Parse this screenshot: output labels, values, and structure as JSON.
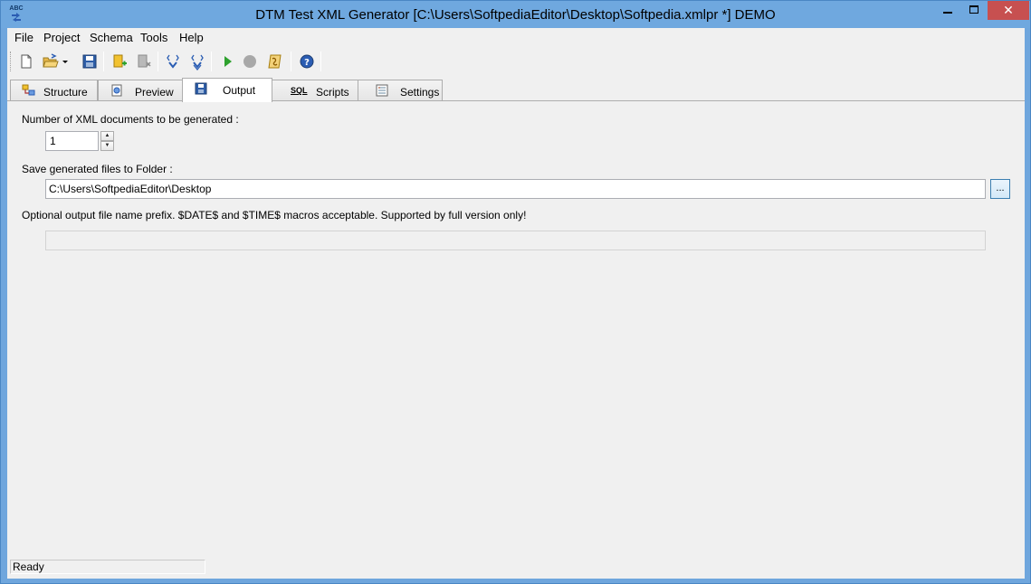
{
  "window": {
    "title": "DTM Test XML Generator [C:\\Users\\SoftpediaEditor\\Desktop\\Softpedia.xmlpr *] DEMO",
    "app_icon_text": "ABC",
    "close_glyph": "✕"
  },
  "menu": [
    "File",
    "Project",
    "Schema",
    "Tools",
    "Help"
  ],
  "toolbar": {
    "buttons": [
      "new-document",
      "open-folder",
      "open-dropdown",
      "save",
      "add-item",
      "remove-item",
      "move-down",
      "move-down-alt",
      "run",
      "stop",
      "script",
      "help"
    ]
  },
  "tabs": [
    {
      "label": "Structure",
      "icon": "structure-icon"
    },
    {
      "label": "Preview",
      "icon": "preview-icon"
    },
    {
      "label": "Output",
      "icon": "save-disk-icon",
      "active": true
    },
    {
      "label": "Scripts",
      "icon": "sql-icon",
      "icon_text": "SQL"
    },
    {
      "label": "Settings",
      "icon": "settings-icon"
    }
  ],
  "output": {
    "count_label": "Number of XML documents to be generated :",
    "count_value": "1",
    "folder_label": "Save generated files to Folder :",
    "folder_value": "C:\\Users\\SoftpediaEditor\\Desktop",
    "browse_label": "...",
    "prefix_label": "Optional output file name prefix. $DATE$ and $TIME$ macros acceptable. Supported by full version only!",
    "prefix_value": ""
  },
  "status": {
    "text": "Ready"
  },
  "colors": {
    "titlebar": "#6fa8df",
    "close_button": "#c75050",
    "panel": "#f0f0f0",
    "run_green": "#2ea12e",
    "help_blue": "#2b5db3"
  }
}
